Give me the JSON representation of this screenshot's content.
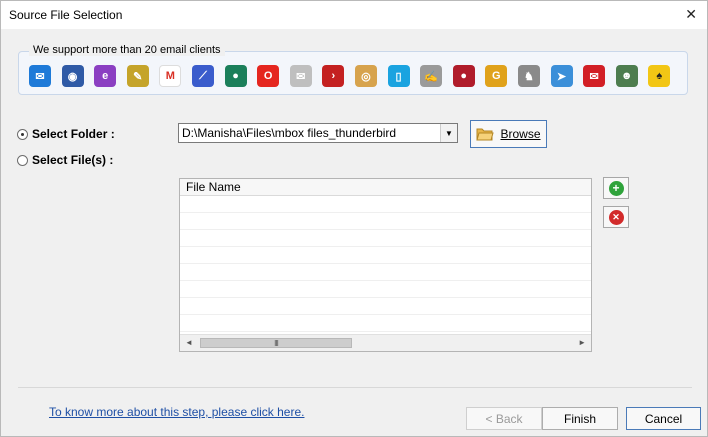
{
  "window": {
    "title": "Source File Selection",
    "close_glyph": "✕"
  },
  "clients": {
    "label": "We support more than 20 email clients",
    "icons": [
      {
        "name": "mail-icon",
        "color": "#1e7ad8",
        "glyph": "✉"
      },
      {
        "name": "thunderbird-icon",
        "color": "#2f5aa6",
        "glyph": "◉"
      },
      {
        "name": "eudora-icon",
        "color": "#8b3fc2",
        "glyph": "e"
      },
      {
        "name": "zimbra-icon",
        "color": "#c5a42a",
        "glyph": "✎"
      },
      {
        "name": "gmail-icon",
        "color": "#ffffff",
        "glyph": "M",
        "fg": "#d93025"
      },
      {
        "name": "postbox-icon",
        "color": "#3a5ccc",
        "glyph": "⟋"
      },
      {
        "name": "seamonkey-icon",
        "color": "#1b7f5a",
        "glyph": "●"
      },
      {
        "name": "opera-icon",
        "color": "#e5261f",
        "glyph": "O"
      },
      {
        "name": "mail-clock-icon",
        "color": "#bfbfbf",
        "glyph": "✉"
      },
      {
        "name": "arrow-circle-icon",
        "color": "#c42121",
        "glyph": "›"
      },
      {
        "name": "globe-mail-icon",
        "color": "#d7a34d",
        "glyph": "◎"
      },
      {
        "name": "blue-file-icon",
        "color": "#1aa3e0",
        "glyph": "▯"
      },
      {
        "name": "hand-mail-icon",
        "color": "#9a9a9a",
        "glyph": "✍"
      },
      {
        "name": "berry-icon",
        "color": "#b01c2b",
        "glyph": "●"
      },
      {
        "name": "gold-g-icon",
        "color": "#e0a21b",
        "glyph": "G"
      },
      {
        "name": "gnu-icon",
        "color": "#8a8a8a",
        "glyph": "♞"
      },
      {
        "name": "paper-plane-icon",
        "color": "#3b8fd9",
        "glyph": "➤"
      },
      {
        "name": "red-envelope-icon",
        "color": "#d21f26",
        "glyph": "✉"
      },
      {
        "name": "person-mail-icon",
        "color": "#4d7d4f",
        "glyph": "☻"
      },
      {
        "name": "bat-icon",
        "color": "#f2c615",
        "glyph": "♠",
        "fg": "#222"
      }
    ]
  },
  "form": {
    "select_folder_label": "Select Folder :",
    "select_files_label": "Select File(s) :",
    "folder_path": "D:\\Manisha\\Files\\mbox files_thunderbird",
    "combo_arrow": "▼",
    "browse_label": "Browse"
  },
  "grid": {
    "column_header": "File Name",
    "scroll_grip": "III",
    "left_arrow": "◄",
    "right_arrow": "►"
  },
  "side_buttons": {
    "add_glyph": "+",
    "remove_glyph": "✕"
  },
  "footer": {
    "help_link": "To know more about this step, please click here.",
    "back_label": "< Back",
    "finish_label": "Finish",
    "cancel_label": "Cancel"
  }
}
